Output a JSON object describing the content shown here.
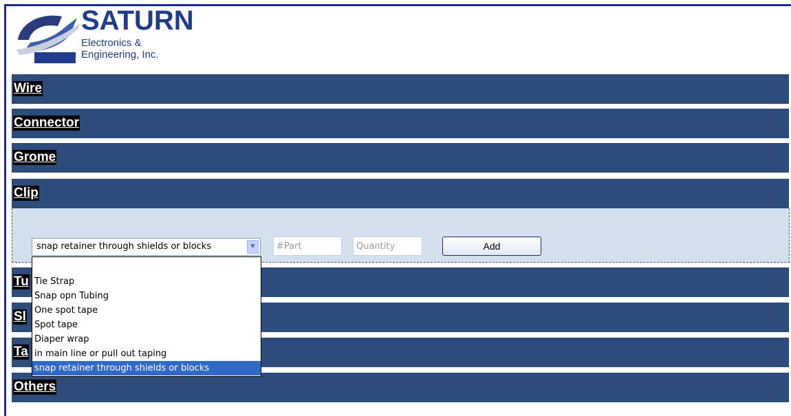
{
  "logo": {
    "title": "SATURN",
    "line1": "Electronics &",
    "line2": "Engineering, Inc."
  },
  "categories": [
    {
      "label": "Wire"
    },
    {
      "label": "Connector"
    },
    {
      "label": "Grome"
    },
    {
      "label": "Clip"
    },
    {
      "label": "Tu"
    },
    {
      "label": "Sl"
    },
    {
      "label": "Ta"
    },
    {
      "label": "Others"
    }
  ],
  "clip_form": {
    "selected": "snap retainer through shields or blocks",
    "part_placeholder": "#Part",
    "quantity_placeholder": "Quantity",
    "add_label": "Add"
  },
  "dropdown_options": [
    "Tie Strap",
    "Snap opn Tubing",
    "One spot tape",
    "Spot tape",
    "Diaper wrap",
    "in main line or pull out taping",
    "snap retainer through shields or blocks"
  ],
  "colors": {
    "bar": "#2e4c79",
    "panel": "#d3e0ee",
    "selected_option": "#3169c6",
    "frame": "#1c2a8c"
  }
}
